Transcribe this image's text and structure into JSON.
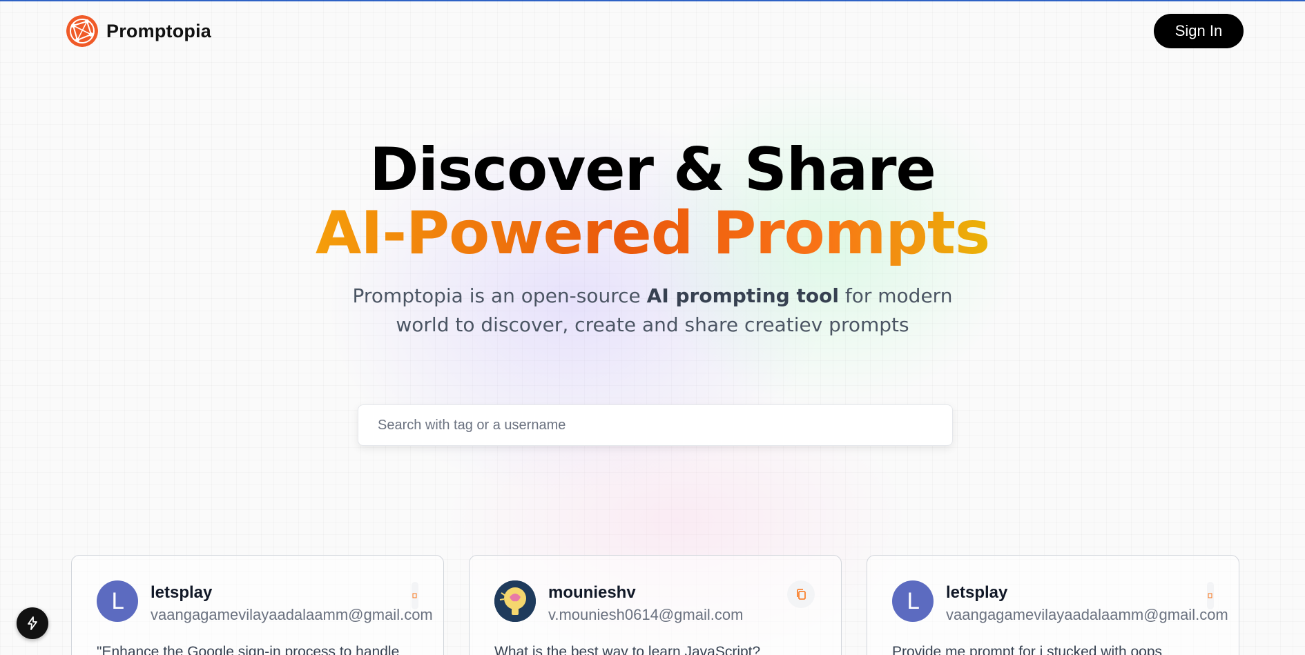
{
  "nav": {
    "brand": "Promptopia",
    "sign_in_label": "Sign In"
  },
  "hero": {
    "title": "Discover & Share",
    "subtitle": "AI-Powered Prompts",
    "description_prefix": "Promptopia is an open-source ",
    "description_bold": "AI prompting tool",
    "description_suffix": " for modern world to discover, create and share creatiev prompts"
  },
  "search": {
    "placeholder": "Search with tag or a username",
    "value": ""
  },
  "cards": [
    {
      "avatar_letter": "L",
      "username": "letsplay",
      "email": "vaangagamevilayaadalaamm@gmail.com",
      "text": "\"Enhance the Google sign-in process to handle"
    },
    {
      "avatar_letter": "",
      "username": "mounieshv",
      "email": "v.mouniesh0614@gmail.com",
      "text": "What is the best way to learn JavaScript?"
    },
    {
      "avatar_letter": "L",
      "username": "letsplay",
      "email": "vaangagamevilayaadalaamm@gmail.com",
      "text": "Provide me prompt for i stucked with oops"
    }
  ],
  "colors": {
    "accent_orange": "#ea580c",
    "brand_black": "#000000",
    "avatar_indigo": "#5c6bc0"
  },
  "icons": {
    "logo": "globe-network-icon",
    "copy": "copy-icon",
    "dev_tools": "lightning-bolt-icon"
  }
}
